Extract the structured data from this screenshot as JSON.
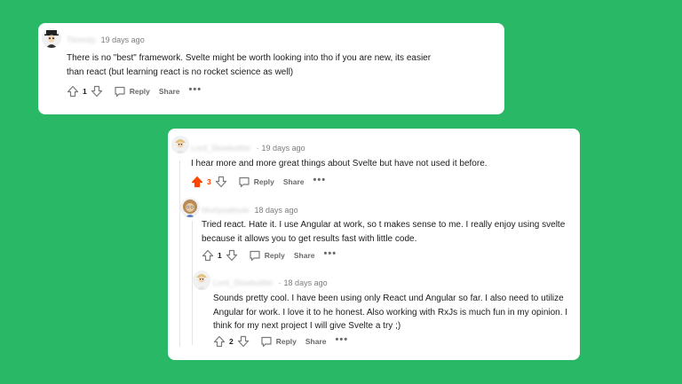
{
  "comments": [
    {
      "username": "Tiimmily",
      "time": "19 days ago",
      "text_lines": [
        "There is no \"best\" framework. Svelte might be worth looking into tho if you are new, its easier",
        "than react (but learning react is no rocket science as well)"
      ],
      "votes": "1",
      "reply_label": "Reply",
      "share_label": "Share",
      "more_label": "•••"
    },
    {
      "username": "Lord_Slowbuttler",
      "time": "19 days ago",
      "text_lines": [
        "I hear more and more great things about Svelte but have not used it before."
      ],
      "votes": "3",
      "upvoted": true,
      "reply_label": "Reply",
      "share_label": "Share",
      "more_label": "•••"
    },
    {
      "username": "Mortywafoule",
      "time": "18 days ago",
      "text_lines": [
        "Tried react. Hate it. I use Angular at work, so t makes sense to me. I really enjoy using svelte",
        "because it allows you to get results fast with little code."
      ],
      "votes": "1",
      "reply_label": "Reply",
      "share_label": "Share",
      "more_label": "•••"
    },
    {
      "username": "Lord_Slowbuttler",
      "time": "18 days ago",
      "text_lines": [
        "Sounds pretty cool. I have been using only React und Angular so far. I also need to utilize",
        "Angular for work. I love it to he honest. Also working with RxJs is much fun in my opinion. I",
        "think for my next project I will give Svelte a try ;)"
      ],
      "votes": "2",
      "reply_label": "Reply",
      "share_label": "Share",
      "more_label": "•••"
    }
  ],
  "colors": {
    "background": "#29b865",
    "upvote_active": "#ff4500"
  },
  "icons": [
    "upvote-icon",
    "downvote-icon",
    "reply-icon",
    "more-icon",
    "avatar"
  ]
}
